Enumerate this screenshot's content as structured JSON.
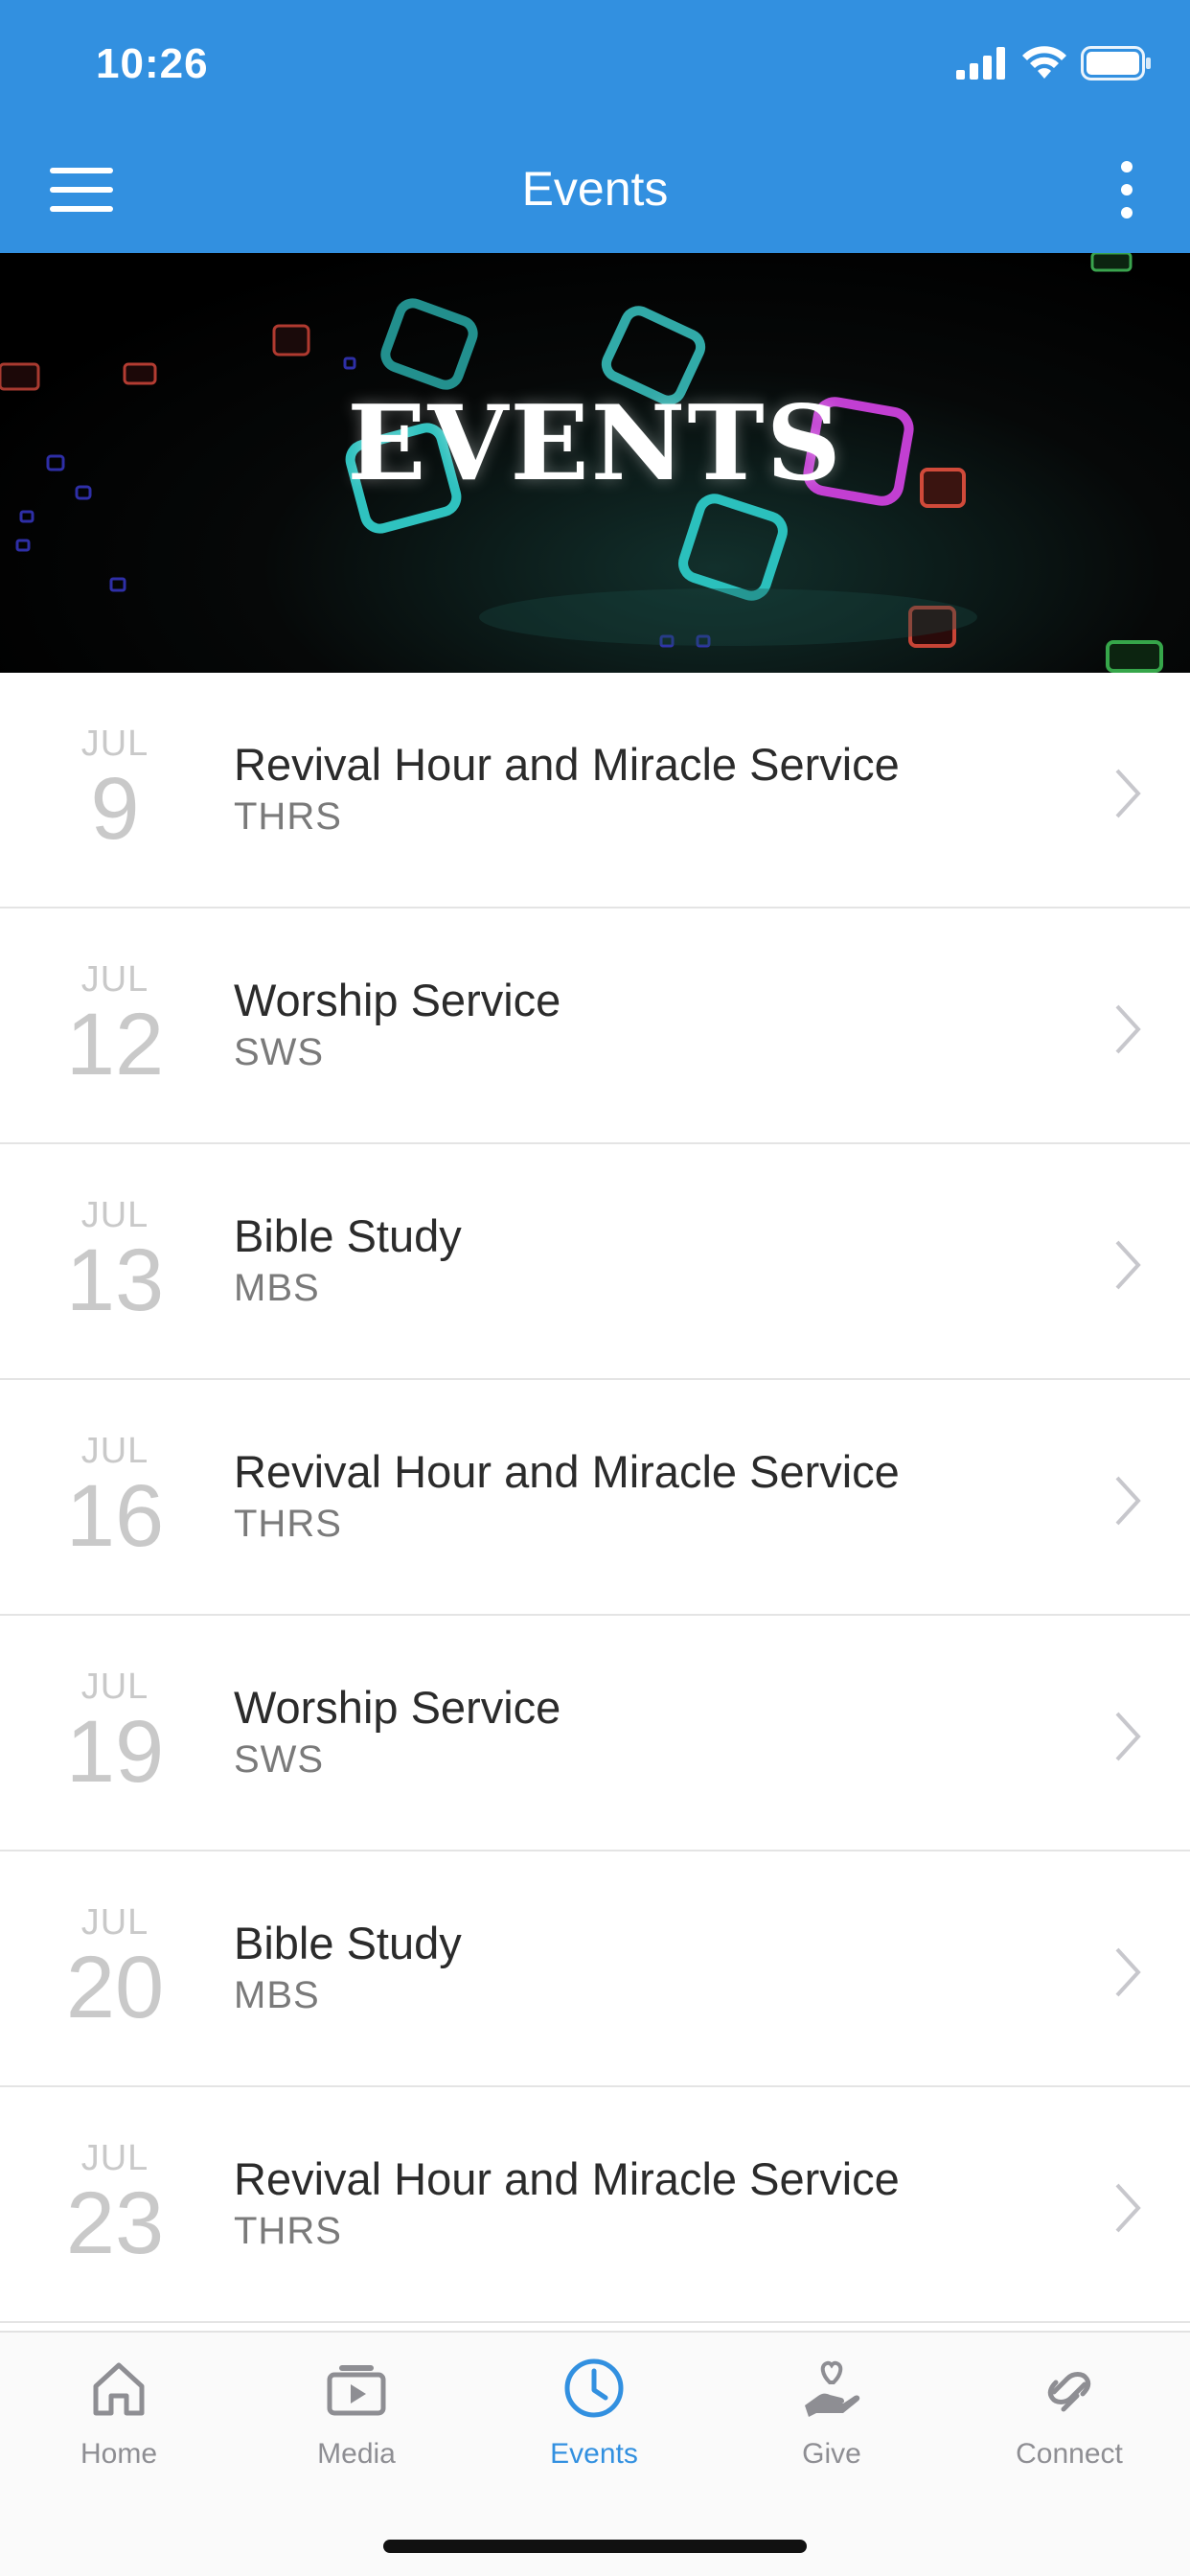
{
  "status_bar": {
    "time": "10:26",
    "icons": [
      "cellular-signal-icon",
      "wifi-icon",
      "battery-icon"
    ]
  },
  "nav_bar": {
    "title": "Events",
    "left_icon": "hamburger-menu-icon",
    "right_icon": "more-vertical-icon",
    "background_color": "#3290e0"
  },
  "banner": {
    "title": "EVENTS"
  },
  "events": [
    {
      "month": "JUL",
      "day": "9",
      "title": "Revival Hour and Miracle Service",
      "code": "THRS"
    },
    {
      "month": "JUL",
      "day": "12",
      "title": "Worship Service",
      "code": "SWS"
    },
    {
      "month": "JUL",
      "day": "13",
      "title": "Bible Study",
      "code": "MBS"
    },
    {
      "month": "JUL",
      "day": "16",
      "title": "Revival Hour and Miracle Service",
      "code": "THRS"
    },
    {
      "month": "JUL",
      "day": "19",
      "title": "Worship Service",
      "code": "SWS"
    },
    {
      "month": "JUL",
      "day": "20",
      "title": "Bible Study",
      "code": "MBS"
    },
    {
      "month": "JUL",
      "day": "23",
      "title": "Revival Hour and Miracle Service",
      "code": "THRS"
    }
  ],
  "tab_bar": {
    "tabs": [
      {
        "label": "Home",
        "icon": "home-icon",
        "active": false
      },
      {
        "label": "Media",
        "icon": "media-play-icon",
        "active": false
      },
      {
        "label": "Events",
        "icon": "clock-icon",
        "active": true
      },
      {
        "label": "Give",
        "icon": "give-hand-heart-icon",
        "active": false
      },
      {
        "label": "Connect",
        "icon": "connect-link-icon",
        "active": false
      }
    ],
    "active_color": "#3290e0",
    "inactive_color": "#8e8e93"
  }
}
